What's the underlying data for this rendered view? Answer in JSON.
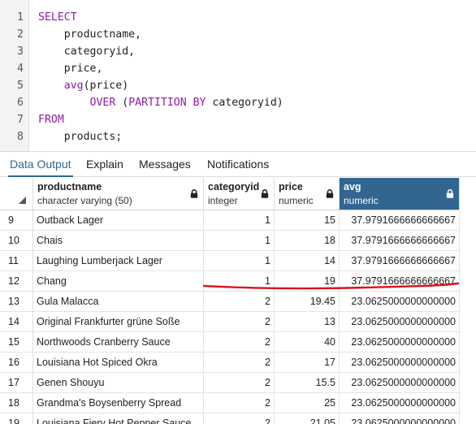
{
  "editor": {
    "lines": [
      {
        "num": "1",
        "parts": [
          {
            "t": "SELECT",
            "k": "kw"
          }
        ]
      },
      {
        "num": "2",
        "parts": [
          {
            "t": "    productname,",
            "k": ""
          }
        ]
      },
      {
        "num": "3",
        "parts": [
          {
            "t": "    categoryid,",
            "k": ""
          }
        ]
      },
      {
        "num": "4",
        "parts": [
          {
            "t": "    price,",
            "k": ""
          }
        ]
      },
      {
        "num": "5",
        "parts": [
          {
            "t": "    ",
            "k": ""
          },
          {
            "t": "avg",
            "k": "fn"
          },
          {
            "t": "(price)",
            "k": ""
          }
        ]
      },
      {
        "num": "6",
        "parts": [
          {
            "t": "        ",
            "k": ""
          },
          {
            "t": "OVER",
            "k": "kw"
          },
          {
            "t": " (",
            "k": ""
          },
          {
            "t": "PARTITION BY",
            "k": "kw"
          },
          {
            "t": " categoryid)",
            "k": ""
          }
        ]
      },
      {
        "num": "7",
        "parts": [
          {
            "t": "FROM",
            "k": "kw"
          }
        ]
      },
      {
        "num": "8",
        "parts": [
          {
            "t": "    products;",
            "k": ""
          }
        ]
      }
    ]
  },
  "tabs": [
    {
      "label": "Data Output",
      "active": true
    },
    {
      "label": "Explain",
      "active": false
    },
    {
      "label": "Messages",
      "active": false
    },
    {
      "label": "Notifications",
      "active": false
    }
  ],
  "columns": [
    {
      "name": "productname",
      "type": "character varying (50)",
      "selected": false
    },
    {
      "name": "categoryid",
      "type": "integer",
      "selected": false
    },
    {
      "name": "price",
      "type": "numeric",
      "selected": false
    },
    {
      "name": "avg",
      "type": "numeric",
      "selected": true
    }
  ],
  "rows": [
    {
      "n": "9",
      "productname": "Outback Lager",
      "categoryid": "1",
      "price": "15",
      "avg": "37.9791666666666667"
    },
    {
      "n": "10",
      "productname": "Chais",
      "categoryid": "1",
      "price": "18",
      "avg": "37.9791666666666667"
    },
    {
      "n": "11",
      "productname": "Laughing Lumberjack Lager",
      "categoryid": "1",
      "price": "14",
      "avg": "37.9791666666666667"
    },
    {
      "n": "12",
      "productname": "Chang",
      "categoryid": "1",
      "price": "19",
      "avg": "37.9791666666666667"
    },
    {
      "n": "13",
      "productname": "Gula Malacca",
      "categoryid": "2",
      "price": "19.45",
      "avg": "23.0625000000000000"
    },
    {
      "n": "14",
      "productname": "Original Frankfurter grüne Soße",
      "categoryid": "2",
      "price": "13",
      "avg": "23.0625000000000000"
    },
    {
      "n": "15",
      "productname": "Northwoods Cranberry Sauce",
      "categoryid": "2",
      "price": "40",
      "avg": "23.0625000000000000"
    },
    {
      "n": "16",
      "productname": "Louisiana Hot Spiced Okra",
      "categoryid": "2",
      "price": "17",
      "avg": "23.0625000000000000"
    },
    {
      "n": "17",
      "productname": "Genen Shouyu",
      "categoryid": "2",
      "price": "15.5",
      "avg": "23.0625000000000000"
    },
    {
      "n": "18",
      "productname": "Grandma's Boysenberry Spread",
      "categoryid": "2",
      "price": "25",
      "avg": "23.0625000000000000"
    },
    {
      "n": "19",
      "productname": "Louisiana Fiery Hot Pepper Sauce",
      "categoryid": "2",
      "price": "21.05",
      "avg": "23.0625000000000000"
    }
  ],
  "colors": {
    "accent": "#326690",
    "keyword": "#8f1ba6",
    "annotation": "#d9121b"
  },
  "icons": {
    "column_lock": "lock-icon",
    "select_all": "select-all-corner-icon"
  }
}
